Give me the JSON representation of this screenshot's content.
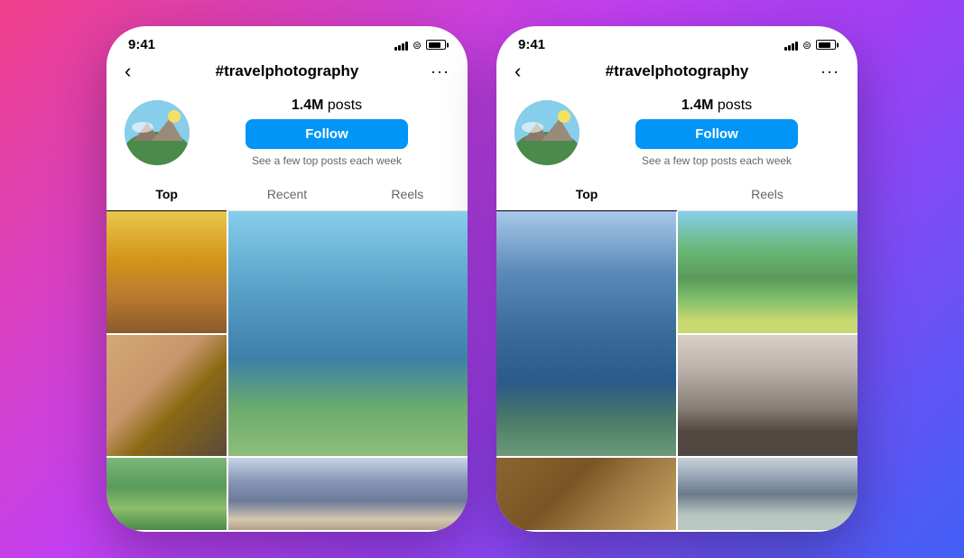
{
  "phones": [
    {
      "id": "phone-left",
      "status": {
        "time": "9:41",
        "battery_level": "80"
      },
      "header": {
        "back_label": "‹",
        "title": "#travelphotography",
        "more_label": "···"
      },
      "profile": {
        "posts_count": "1.4M",
        "posts_label": "posts",
        "follow_label": "Follow",
        "see_posts_text": "See a few top posts each week"
      },
      "tabs": [
        {
          "label": "Top",
          "active": true
        },
        {
          "label": "Recent",
          "active": false
        },
        {
          "label": "Reels",
          "active": false
        }
      ]
    },
    {
      "id": "phone-right",
      "status": {
        "time": "9:41",
        "battery_level": "80"
      },
      "header": {
        "back_label": "‹",
        "title": "#travelphotography",
        "more_label": "···"
      },
      "profile": {
        "posts_count": "1.4M",
        "posts_label": "posts",
        "follow_label": "Follow",
        "see_posts_text": "See a few top posts each week"
      },
      "tabs": [
        {
          "label": "Top",
          "active": true
        },
        {
          "label": "Reels",
          "active": false
        }
      ]
    }
  ]
}
